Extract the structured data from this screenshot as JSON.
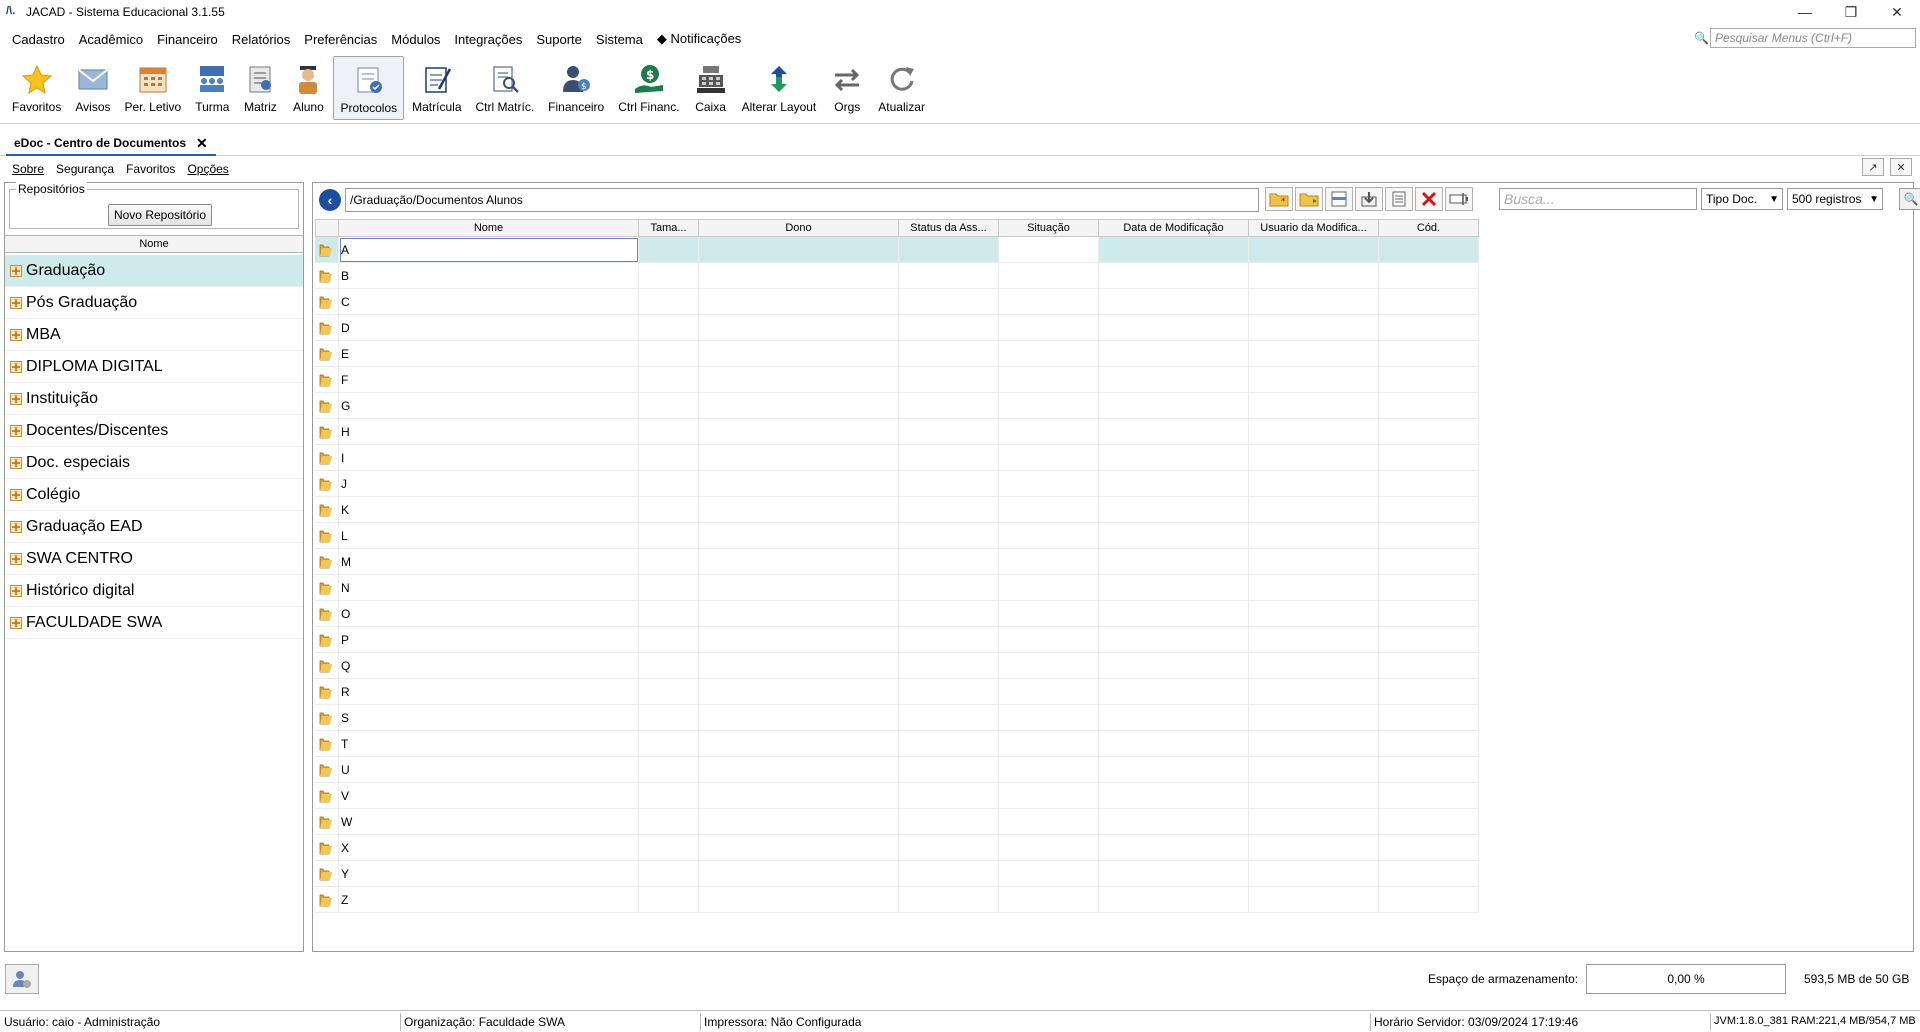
{
  "window": {
    "title": "JACAD - Sistema Educacional 3.1.55",
    "app_icon": "/\\.",
    "controls": [
      "—",
      "❐",
      "✕"
    ]
  },
  "menu": {
    "items": [
      "Cadastro",
      "Acadêmico",
      "Financeiro",
      "Relatórios",
      "Preferências",
      "Módulos",
      "Integrações",
      "Suporte",
      "Sistema",
      "Notificações"
    ],
    "search_placeholder": "Pesquisar Menus (Ctrl+F)"
  },
  "toolbar": {
    "items": [
      {
        "label": "Favoritos",
        "icon": "star-icon"
      },
      {
        "label": "Avisos",
        "icon": "envelope-icon"
      },
      {
        "label": "Per. Letivo",
        "icon": "calendar-icon"
      },
      {
        "label": "Turma",
        "icon": "class-group-icon"
      },
      {
        "label": "Matriz",
        "icon": "curriculum-icon"
      },
      {
        "label": "Aluno",
        "icon": "student-icon"
      },
      {
        "label": "Protocolos",
        "icon": "protocol-icon"
      },
      {
        "label": "Matrícula",
        "icon": "enrollment-icon"
      },
      {
        "label": "Ctrl Matríc.",
        "icon": "enrollment-control-icon"
      },
      {
        "label": "Financeiro",
        "icon": "finance-person-icon"
      },
      {
        "label": "Ctrl Financ.",
        "icon": "money-hand-icon"
      },
      {
        "label": "Caixa",
        "icon": "cash-register-icon"
      },
      {
        "label": "Alterar Layout",
        "icon": "layout-swap-icon"
      },
      {
        "label": "Orgs",
        "icon": "orgs-icon"
      },
      {
        "label": "Atualizar",
        "icon": "refresh-icon"
      }
    ]
  },
  "tab": {
    "label": "eDoc - Centro de Documentos",
    "close": "✕"
  },
  "submenu": {
    "items": [
      "Sobre",
      "Segurança",
      "Favoritos",
      "Opções"
    ]
  },
  "left": {
    "group_label": "Repositórios",
    "new_repo_button": "Novo Repositório",
    "column_header": "Nome",
    "items": [
      "Graduação",
      "Pós Graduação",
      "MBA",
      "DIPLOMA DIGITAL",
      "Instituição",
      "Docentes/Discentes",
      "Doc. especiais",
      "Colégio",
      "Graduação EAD",
      "SWA CENTRO",
      "Histórico digital",
      "FACULDADE SWA"
    ]
  },
  "main": {
    "path": "/Graduação/Documentos Alunos",
    "search_placeholder": "Busca...",
    "doc_type": "Tipo Doc.",
    "records": "500 registros",
    "columns": [
      "Nome",
      "Tama...",
      "Dono",
      "Status da Ass...",
      "Situação",
      "Data de Modificação",
      "Usuario da Modifica...",
      "Cód."
    ],
    "rows": [
      "A",
      "B",
      "C",
      "D",
      "E",
      "F",
      "G",
      "H",
      "I",
      "J",
      "K",
      "L",
      "M",
      "N",
      "O",
      "P",
      "Q",
      "R",
      "S",
      "T",
      "U",
      "V",
      "W",
      "X",
      "Y",
      "Z"
    ]
  },
  "storage": {
    "label": "Espaço de armazenamento:",
    "percent": "0,00 %",
    "size": "593,5 MB  de 50 GB"
  },
  "status": {
    "user": "Usuário: caio - Administração",
    "org": "Organização: Faculdade SWA",
    "printer": "Impressora: Não Configurada",
    "server_time": "Horário Servidor: 03/09/2024 17:19:46",
    "jvm": "JVM:1.8.0_381  RAM:221,4 MB/954,7 MB"
  },
  "colors": {
    "selection": "#cfeaea",
    "accent": "#1e4f9c"
  }
}
